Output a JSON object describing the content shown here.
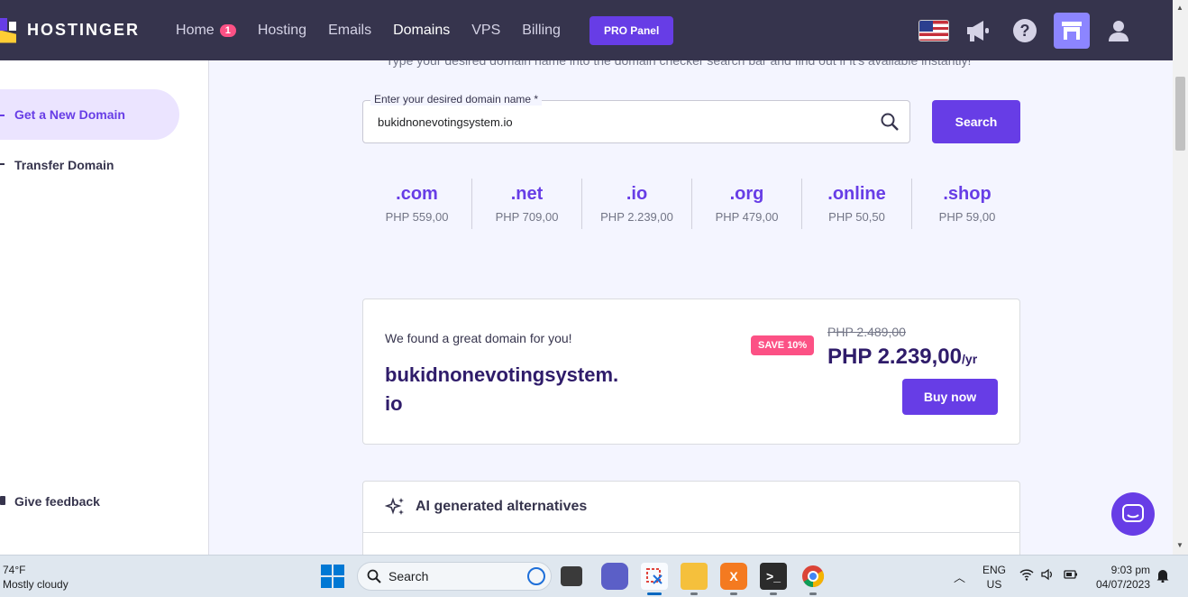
{
  "topnav": {
    "brand": "HOSTINGER",
    "items": [
      {
        "label": "Home",
        "badge": "1"
      },
      {
        "label": "Hosting"
      },
      {
        "label": "Emails"
      },
      {
        "label": "Domains",
        "active": true
      },
      {
        "label": "VPS"
      },
      {
        "label": "Billing"
      }
    ],
    "pro_label": "PRO Panel",
    "icons": [
      "us-flag-icon",
      "megaphone-icon",
      "help-icon",
      "store-icon",
      "user-icon"
    ]
  },
  "sidebar": {
    "items": [
      {
        "label": "Get a New Domain",
        "active": true
      },
      {
        "label": "Transfer Domain"
      }
    ],
    "feedback_label": "Give feedback"
  },
  "main": {
    "subtext": "Type your desired domain name into the domain checker search bar and find out if it's available instantly!",
    "search": {
      "label": "Enter your desired domain name *",
      "value": "bukidnonevotingsystem.io",
      "button": "Search"
    },
    "tlds": [
      {
        "name": ".com",
        "price": "PHP 559,00"
      },
      {
        "name": ".net",
        "price": "PHP 709,00"
      },
      {
        "name": ".io",
        "price": "PHP 2.239,00"
      },
      {
        "name": ".org",
        "price": "PHP 479,00"
      },
      {
        "name": ".online",
        "price": "PHP 50,50"
      },
      {
        "name": ".shop",
        "price": "PHP 59,00"
      }
    ],
    "result": {
      "found_text": "We found a great domain for you!",
      "domain": "bukidnonevotingsystem.io",
      "save_badge": "SAVE 10%",
      "old_price": "PHP 2.489,00",
      "new_price": "PHP 2.239,00",
      "period": "/yr",
      "buy_label": "Buy now"
    },
    "ai_title": "AI generated alternatives"
  },
  "taskbar": {
    "weather_temp": "74°F",
    "weather_desc": "Mostly cloudy",
    "search_label": "Search",
    "lang_1": "ENG",
    "lang_2": "US",
    "time": "9:03 pm",
    "date": "04/07/2023"
  },
  "colors": {
    "brand": "#673de6",
    "nav_bg": "#36344d",
    "accent_pink": "#fc5185",
    "page_bg": "#f4f5ff"
  }
}
